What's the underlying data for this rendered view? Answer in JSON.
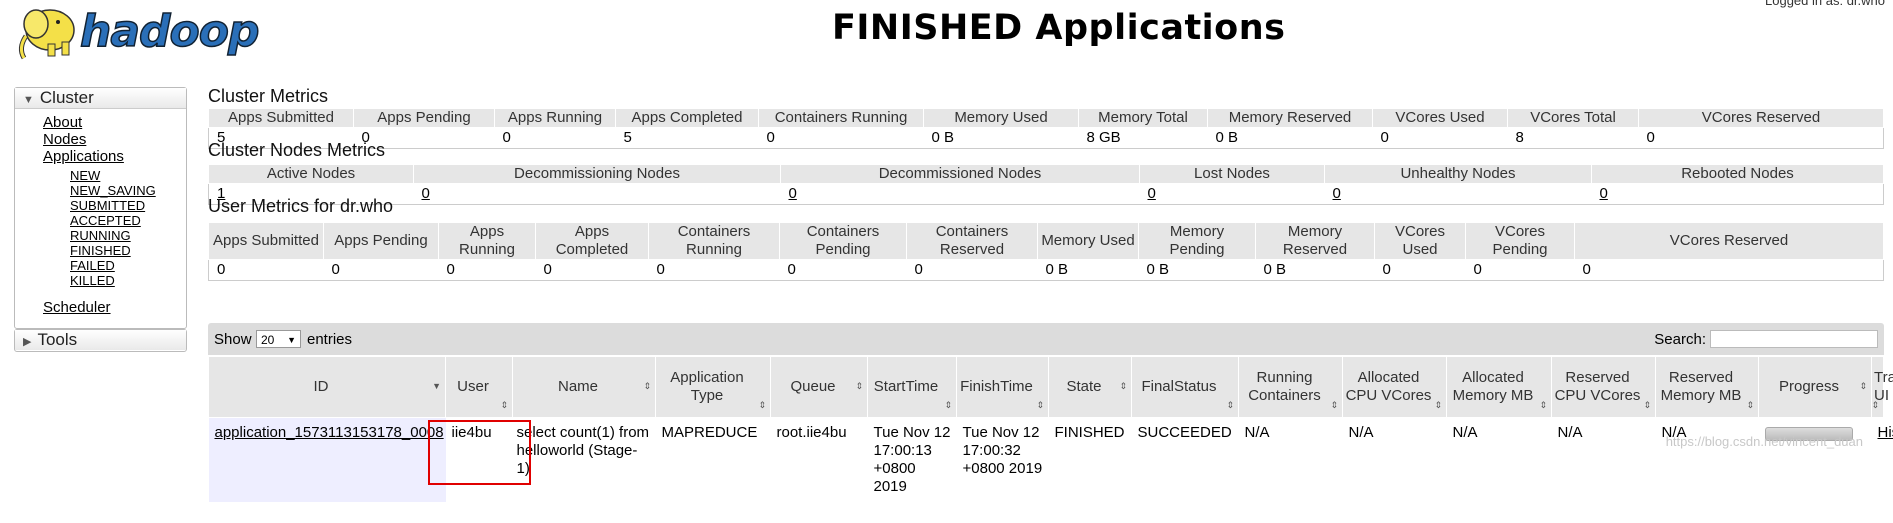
{
  "header": {
    "logo_text": "hadoop",
    "title": "FINISHED Applications",
    "logged_in": "Logged in as: dr.who"
  },
  "sidebar": {
    "cluster": {
      "label": "Cluster",
      "items": [
        {
          "label": "About"
        },
        {
          "label": "Nodes"
        },
        {
          "label": "Applications"
        }
      ],
      "app_states": [
        "NEW",
        "NEW_SAVING",
        "SUBMITTED",
        "ACCEPTED",
        "RUNNING",
        "FINISHED",
        "FAILED",
        "KILLED"
      ],
      "scheduler": "Scheduler"
    },
    "tools": {
      "label": "Tools"
    }
  },
  "cluster_metrics": {
    "title": "Cluster Metrics",
    "headers": [
      "Apps Submitted",
      "Apps Pending",
      "Apps Running",
      "Apps Completed",
      "Containers Running",
      "Memory Used",
      "Memory Total",
      "Memory Reserved",
      "VCores Used",
      "VCores Total",
      "VCores Reserved"
    ],
    "values": [
      "5",
      "0",
      "0",
      "5",
      "0",
      "0 B",
      "8 GB",
      "0 B",
      "0",
      "8",
      "0"
    ]
  },
  "cluster_nodes_metrics": {
    "title": "Cluster Nodes Metrics",
    "headers": [
      "Active Nodes",
      "Decommissioning Nodes",
      "Decommissioned Nodes",
      "Lost Nodes",
      "Unhealthy Nodes",
      "Rebooted Nodes"
    ],
    "values": [
      "1",
      "0",
      "0",
      "0",
      "0",
      "0"
    ]
  },
  "user_metrics": {
    "title": "User Metrics for dr.who",
    "headers": [
      "Apps Submitted",
      "Apps Pending",
      "Apps Running",
      "Apps Completed",
      "Containers Running",
      "Containers Pending",
      "Containers Reserved",
      "Memory Used",
      "Memory Pending",
      "Memory Reserved",
      "VCores Used",
      "VCores Pending",
      "VCores Reserved"
    ],
    "values": [
      "0",
      "0",
      "0",
      "0",
      "0",
      "0",
      "0",
      "0 B",
      "0 B",
      "0 B",
      "0",
      "0",
      "0"
    ]
  },
  "apps_table": {
    "show_label": "Show",
    "page_length": "20",
    "entries_label": "entries",
    "search_label": "Search:",
    "search_value": "",
    "headers": [
      "ID",
      "User",
      "Name",
      "Application Type",
      "Queue",
      "StartTime",
      "FinishTime",
      "State",
      "FinalStatus",
      "Running Containers",
      "Allocated CPU VCores",
      "Allocated Memory MB",
      "Reserved CPU VCores",
      "Reserved Memory MB",
      "Progress",
      "Tracking UI"
    ],
    "rows": [
      {
        "id": "application_1573113153178_0008",
        "user": "iie4bu",
        "name": "select count(1) from helloworld (Stage-1)",
        "type": "MAPREDUCE",
        "queue": "root.iie4bu",
        "start_time": "Tue Nov 12 17:00:13 +0800 2019",
        "finish_time": "Tue Nov 12 17:00:32 +0800 2019",
        "state": "FINISHED",
        "final_status": "SUCCEEDED",
        "running_containers": "N/A",
        "alloc_cpu": "N/A",
        "alloc_mem": "N/A",
        "res_cpu": "N/A",
        "res_mem": "N/A",
        "progress": 1.0,
        "tracking_ui": "History"
      }
    ]
  },
  "watermark": "https://blog.csdn.net/vincent_duan"
}
